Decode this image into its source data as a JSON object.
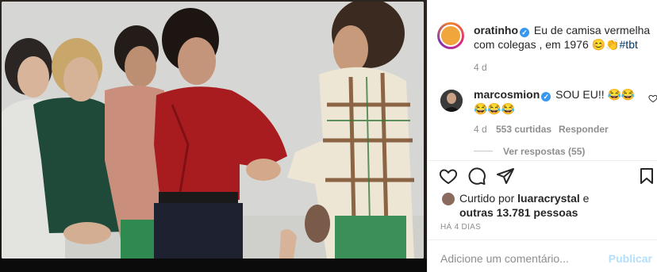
{
  "post": {
    "username": "oratinho",
    "caption_text": "Eu de camisa vermelha com colegas , em 1976",
    "caption_emojis": "😊👏",
    "hashtag": "#tbt",
    "age": "4 d"
  },
  "comment": {
    "username": "marcosmion",
    "text": "SOU EU!!",
    "emojis": "😂😂😂😂😂",
    "age": "4 d",
    "likes": "553 curtidas",
    "reply_label": "Responder",
    "view_replies": "Ver respostas (55)"
  },
  "likes": {
    "prefix": "Curtido por",
    "user": "luaracrystal",
    "connector": "e",
    "others": "outras 13.781 pessoas"
  },
  "timestamp": "HÁ 4 DIAS",
  "comment_box": {
    "placeholder": "Adicione um comentário...",
    "publish_label": "Publicar"
  },
  "icons": {
    "verified": "verified-badge-icon",
    "like": "heart-icon",
    "comment": "comment-bubble-icon",
    "share": "paper-plane-icon",
    "save": "bookmark-icon"
  },
  "colors": {
    "link": "#00376b",
    "verified": "#3897f0",
    "muted": "#8e8e8e",
    "publish": "#b2dffc"
  }
}
